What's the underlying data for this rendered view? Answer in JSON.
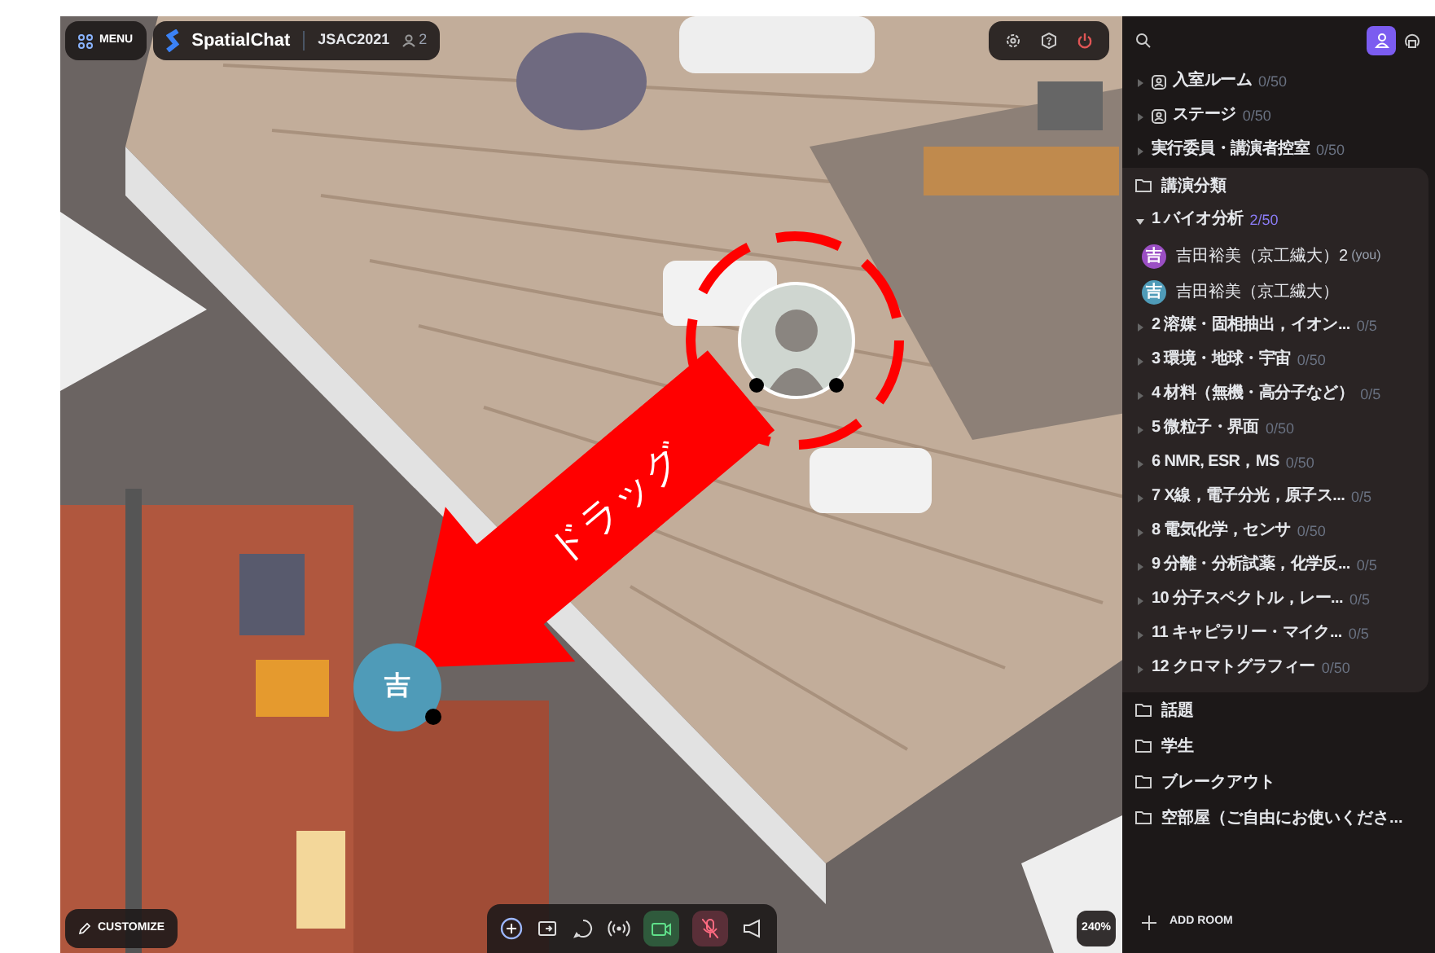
{
  "top_bar": {
    "menu": "MENU",
    "app_name": "SpatialChat",
    "space": "JSAC2021",
    "user_count": "2"
  },
  "canvas": {
    "annotation": "ドラッグ",
    "avatars": [
      {
        "kind": "video"
      },
      {
        "kind": "initial",
        "initial": "吉"
      }
    ]
  },
  "bottom_bar": {
    "customize": "CUSTOMIZE",
    "camera_on": true,
    "mic_on": false,
    "zoom": "240%"
  },
  "sidebar": {
    "items": [
      {
        "kind": "room_icon",
        "name": "入室ルーム",
        "count": "0/50",
        "expanded": false
      },
      {
        "kind": "room_icon",
        "name": "ステージ",
        "count": "0/50",
        "expanded": false
      },
      {
        "kind": "room",
        "name": "実行委員・講演者控室",
        "count": "0/50",
        "expanded": false
      },
      {
        "kind": "folder",
        "name": "講演分類",
        "expanded": true,
        "children": [
          {
            "kind": "room",
            "name": "1 バイオ分析",
            "count": "2/50",
            "expanded": true,
            "members": [
              {
                "initial": "吉",
                "name": "吉田裕美（京工繊大）2",
                "tag": "(you)",
                "color": "#9b4fc4"
              },
              {
                "initial": "吉",
                "name": "吉田裕美（京工繊大）",
                "color": "#4f9bb8"
              }
            ]
          },
          {
            "kind": "room",
            "name": "2 溶媒・固相抽出，イオン...",
            "count": "0/5",
            "expanded": false
          },
          {
            "kind": "room",
            "name": "3 環境・地球・宇宙",
            "count": "0/50",
            "expanded": false
          },
          {
            "kind": "room",
            "name": "4 材料（無機・高分子など）",
            "count": "0/5",
            "expanded": false
          },
          {
            "kind": "room",
            "name": "5 微粒子・界面",
            "count": "0/50",
            "expanded": false
          },
          {
            "kind": "room",
            "name": "6 NMR, ESR，MS",
            "count": "0/50",
            "expanded": false
          },
          {
            "kind": "room",
            "name": "7 X線，電子分光，原子ス...",
            "count": "0/5",
            "expanded": false
          },
          {
            "kind": "room",
            "name": "8 電気化学，センサ",
            "count": "0/50",
            "expanded": false
          },
          {
            "kind": "room",
            "name": "9 分離・分析試薬，化学反...",
            "count": "0/5",
            "expanded": false
          },
          {
            "kind": "room",
            "name": "10 分子スペクトル，レー...",
            "count": "0/5",
            "expanded": false
          },
          {
            "kind": "room",
            "name": "11 キャピラリー・マイク...",
            "count": "0/5",
            "expanded": false
          },
          {
            "kind": "room",
            "name": "12 クロマトグラフィー",
            "count": "0/50",
            "expanded": false
          }
        ]
      },
      {
        "kind": "folder",
        "name": "話題",
        "expanded": false
      },
      {
        "kind": "folder",
        "name": "学生",
        "expanded": false
      },
      {
        "kind": "folder",
        "name": "ブレークアウト",
        "expanded": false
      },
      {
        "kind": "folder",
        "name": "空部屋（ご自由にお使いくださ...",
        "expanded": false
      }
    ],
    "add_room": "ADD ROOM"
  }
}
